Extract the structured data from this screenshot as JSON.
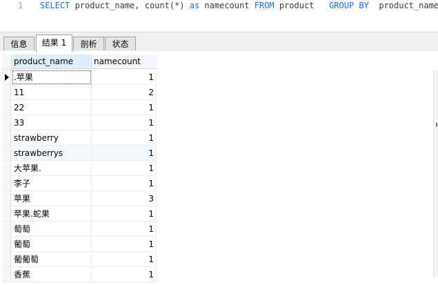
{
  "editor": {
    "line_number": "1",
    "tokens": [
      {
        "text": "SELECT",
        "kind": "keyword"
      },
      {
        "text": " product_name, count(*) ",
        "kind": "plain"
      },
      {
        "text": "as",
        "kind": "keyword"
      },
      {
        "text": " namecount ",
        "kind": "plain"
      },
      {
        "text": "FROM",
        "kind": "keyword"
      },
      {
        "text": " product   ",
        "kind": "plain"
      },
      {
        "text": "GROUP BY",
        "kind": "keyword"
      },
      {
        "text": "  product_name",
        "kind": "plain"
      }
    ],
    "colors": {
      "keyword": "#1f6fd6",
      "plain": "#3a3a3a"
    }
  },
  "tabs": [
    {
      "label": "信息",
      "active": false
    },
    {
      "label": "结果 1",
      "active": true
    },
    {
      "label": "剖析",
      "active": false
    },
    {
      "label": "状态",
      "active": false
    }
  ],
  "grid": {
    "columns": [
      "product_name",
      "namecount"
    ],
    "rows": [
      {
        "product_name": ".苹果",
        "namecount": "1"
      },
      {
        "product_name": "11",
        "namecount": "2"
      },
      {
        "product_name": "22",
        "namecount": "1"
      },
      {
        "product_name": "33",
        "namecount": "1"
      },
      {
        "product_name": "strawberry",
        "namecount": "1"
      },
      {
        "product_name": "strawberrys",
        "namecount": "1"
      },
      {
        "product_name": "大苹果.",
        "namecount": "1"
      },
      {
        "product_name": "李子",
        "namecount": "1"
      },
      {
        "product_name": "苹果",
        "namecount": "3"
      },
      {
        "product_name": "苹果.蛇果",
        "namecount": "1"
      },
      {
        "product_name": "萄萄",
        "namecount": "1"
      },
      {
        "product_name": "葡萄",
        "namecount": "1"
      },
      {
        "product_name": "葡葡萄",
        "namecount": "1"
      },
      {
        "product_name": "香蕉",
        "namecount": "1"
      }
    ],
    "selected_row": 0,
    "highlighted_row": 5,
    "row_indicator_icon": "current-row-arrow-icon"
  }
}
